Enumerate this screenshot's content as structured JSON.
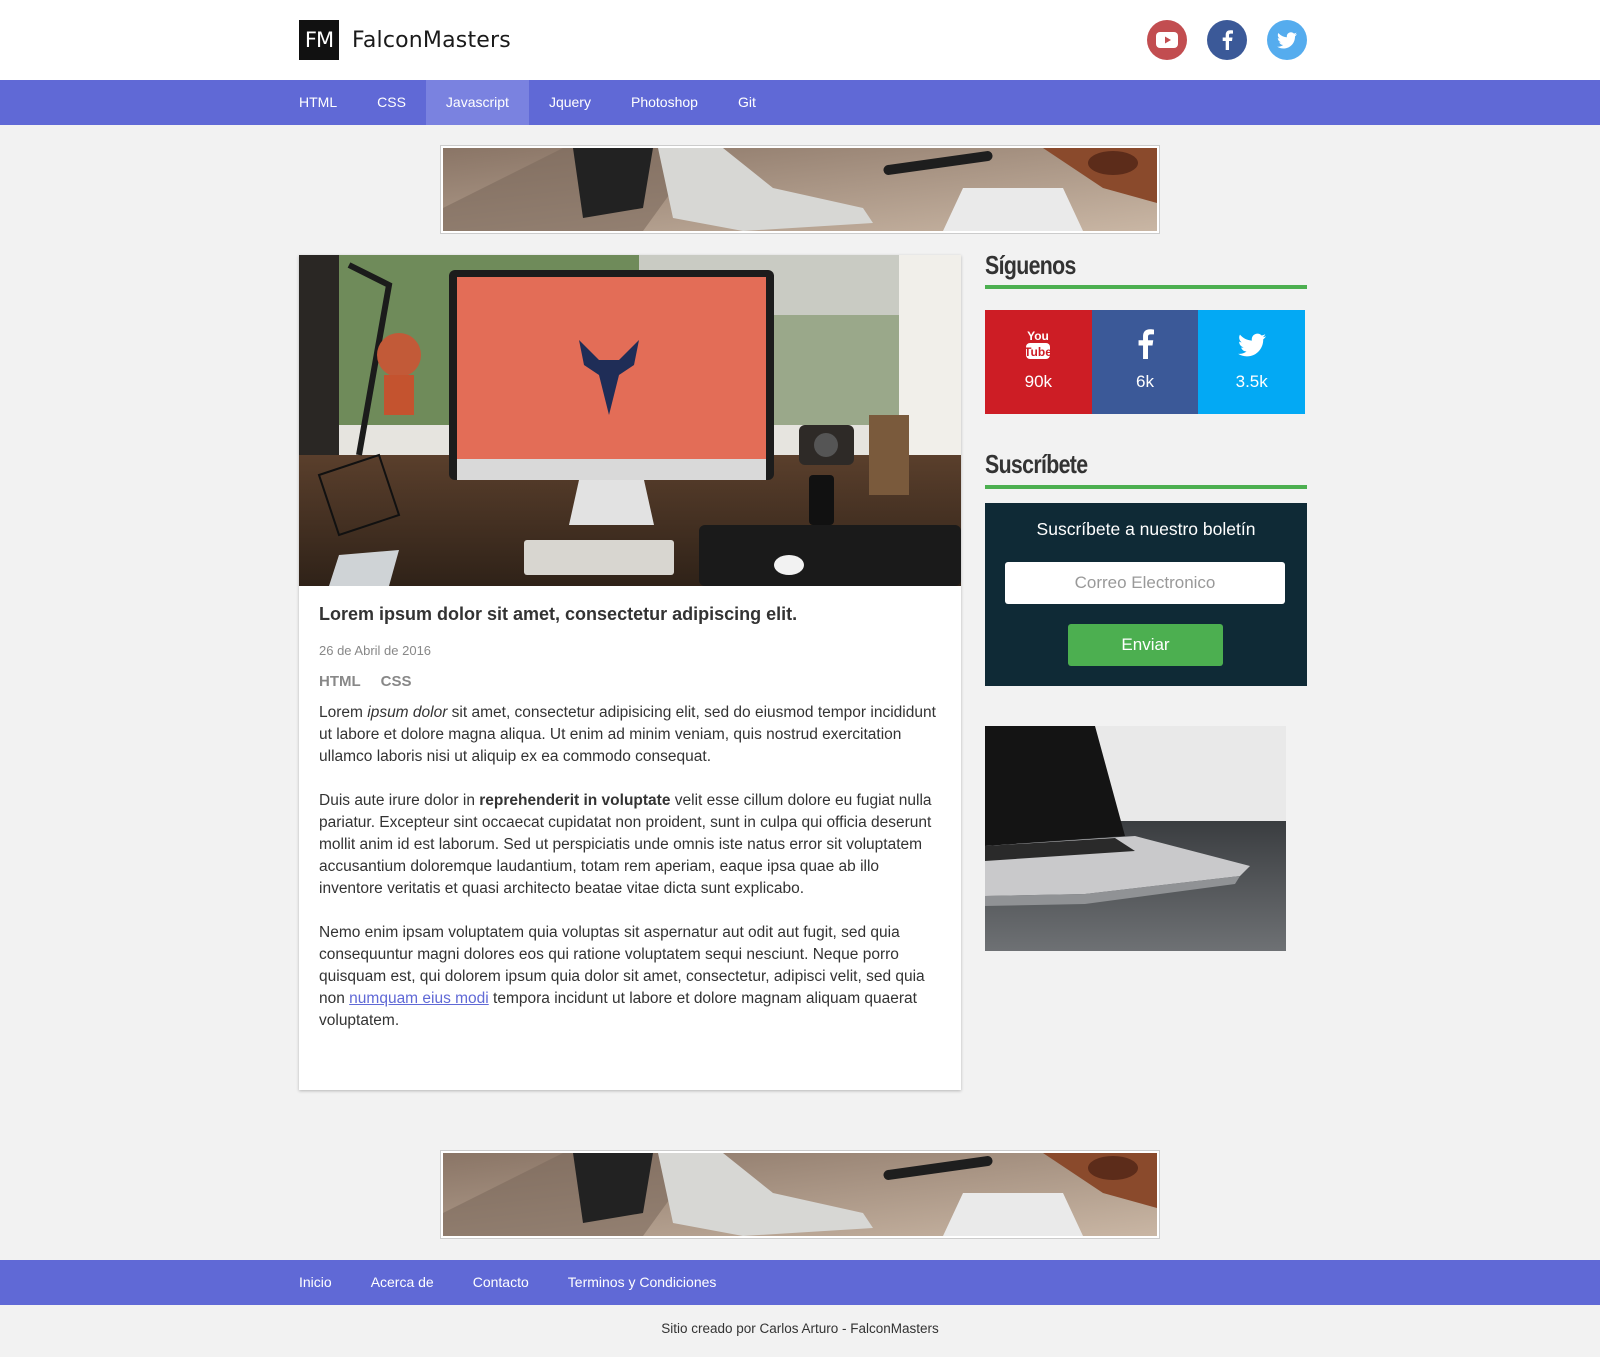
{
  "header": {
    "logo_mark": "FM",
    "logo_text": "FalconMasters",
    "social_icons": [
      "youtube-icon",
      "facebook-icon",
      "twitter-icon"
    ],
    "colors": {
      "youtube": "#c24d50",
      "facebook": "#3b5998",
      "twitter": "#55acee"
    }
  },
  "nav": {
    "items": [
      "HTML",
      "CSS",
      "Javascript",
      "Jquery",
      "Photoshop",
      "Git"
    ],
    "active": "Javascript",
    "color": "#6069d6"
  },
  "article": {
    "title": "Lorem ipsum dolor sit amet, consectetur adipiscing elit.",
    "date": "26 de Abril de 2016",
    "tags": [
      "HTML",
      "CSS"
    ],
    "p1": {
      "start": "Lorem ",
      "italic": "ipsum dolor",
      "end": " sit amet, consectetur adipisicing elit, sed do eiusmod tempor incididunt ut labore et dolore magna aliqua. Ut enim ad minim veniam, quis nostrud exercitation ullamco laboris nisi ut aliquip ex ea commodo consequat."
    },
    "p2": {
      "start": "Duis aute irure dolor in ",
      "bold": "reprehenderit in voluptate",
      "end": " velit esse cillum dolore eu fugiat nulla pariatur. Excepteur sint occaecat cupidatat non proident, sunt in culpa qui officia deserunt mollit anim id est laborum. Sed ut perspiciatis unde omnis iste natus error sit voluptatem accusantium doloremque laudantium, totam rem aperiam, eaque ipsa quae ab illo inventore veritatis et quasi architecto beatae vitae dicta sunt explicabo."
    },
    "p3": {
      "start": "Nemo enim ipsam voluptatem quia voluptas sit aspernatur aut odit aut fugit, sed quia consequuntur magni dolores eos qui ratione voluptatem sequi nesciunt. Neque porro quisquam est, qui dolorem ipsum quia dolor sit amet, consectetur, adipisci velit, sed quia non ",
      "link": "numquam eius modi",
      "end": " tempora incidunt ut labore et dolore magnam aliquam quaerat voluptatem."
    }
  },
  "sidebar": {
    "follow_title": "Síguenos",
    "social": [
      {
        "icon": "youtube-icon",
        "count": "90k",
        "color": "#cd1d25"
      },
      {
        "icon": "facebook-icon",
        "count": "6k",
        "color": "#3b5998"
      },
      {
        "icon": "twitter-icon",
        "count": "3.5k",
        "color": "#03a9f4"
      }
    ],
    "subscribe_title": "Suscríbete",
    "subscribe_text": "Suscríbete a nuestro boletín",
    "email_placeholder": "Correo Electronico",
    "send_label": "Enviar",
    "accent": "#4caf50"
  },
  "footer": {
    "links": [
      "Inicio",
      "Acerca de",
      "Contacto",
      "Terminos y Condiciones"
    ],
    "credit": "Sitio creado por Carlos Arturo - FalconMasters"
  }
}
